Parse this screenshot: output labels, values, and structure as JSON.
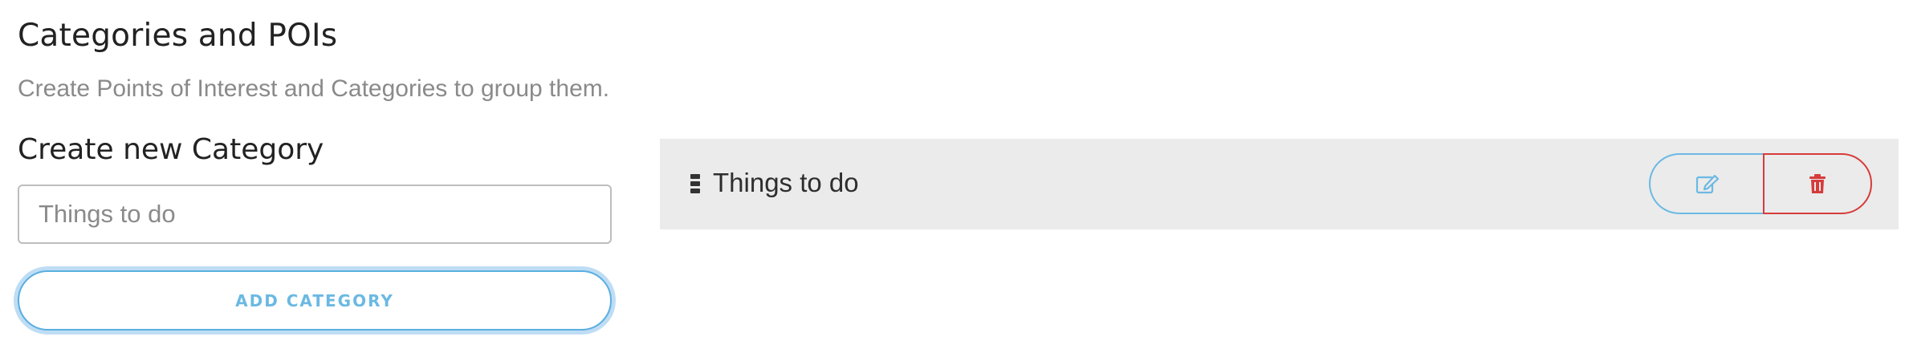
{
  "header": {
    "title": "Categories and POIs",
    "subtitle": "Create Points of Interest and Categories to group them."
  },
  "create_category": {
    "title": "Create new Category",
    "input_value": "",
    "input_placeholder": "Things to do",
    "add_button_label": "ADD CATEGORY"
  },
  "categories": [
    {
      "label": "Things to do"
    }
  ],
  "icons": {
    "drag": "drag-handle-icon",
    "edit": "edit-icon",
    "delete": "trash-icon"
  },
  "colors": {
    "accent_blue": "#6bb9e3",
    "danger_red": "#d63b3b",
    "row_background": "#ebebeb"
  }
}
